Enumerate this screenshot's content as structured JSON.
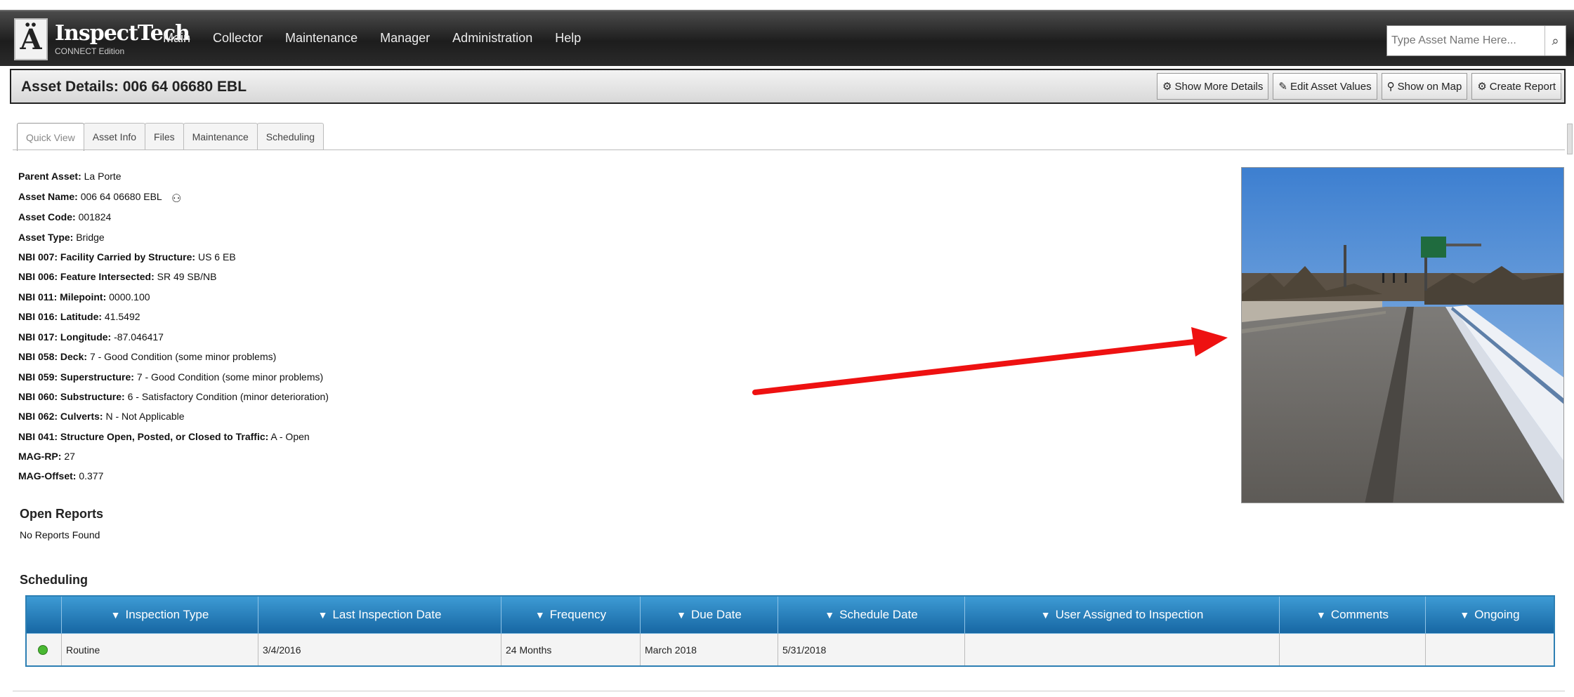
{
  "app": {
    "logo_name": "InspectTech",
    "logo_sub": "CONNECT Edition",
    "nav": [
      "Main",
      "Collector",
      "Maintenance",
      "Manager",
      "Administration",
      "Help"
    ],
    "search": {
      "placeholder": "Type Asset Name Here..."
    }
  },
  "header": {
    "title": "Asset Details: 006 64 06680 EBL",
    "actions": [
      {
        "label": "Show More Details",
        "icon": "gear-icon"
      },
      {
        "label": "Edit Asset Values",
        "icon": "edit-icon"
      },
      {
        "label": "Show on Map",
        "icon": "map-pin-icon"
      },
      {
        "label": "Create Report",
        "icon": "gear-icon"
      }
    ]
  },
  "tabs": [
    "Quick View",
    "Asset Info",
    "Files",
    "Maintenance",
    "Scheduling"
  ],
  "active_tab": "Quick View",
  "fields": [
    {
      "label": "Parent Asset:",
      "value": "La Porte"
    },
    {
      "label": "Asset Name:",
      "value": "006 64 06680 EBL"
    },
    {
      "label": "Asset Code:",
      "value": "001824"
    },
    {
      "label": "Asset Type:",
      "value": "Bridge"
    },
    {
      "label": "NBI 007: Facility Carried by Structure:",
      "value": "US 6 EB"
    },
    {
      "label": "NBI 006: Feature Intersected:",
      "value": "SR 49 SB/NB"
    },
    {
      "label": "NBI 011: Milepoint:",
      "value": "0000.100"
    },
    {
      "label": "NBI 016: Latitude:",
      "value": "41.5492"
    },
    {
      "label": "NBI 017: Longitude:",
      "value": "-87.046417"
    },
    {
      "label": "NBI 058: Deck:",
      "value": "7 - Good Condition (some minor problems)"
    },
    {
      "label": "NBI 059: Superstructure:",
      "value": "7 - Good Condition (some minor problems)"
    },
    {
      "label": "NBI 060: Substructure:",
      "value": "6 - Satisfactory Condition (minor deterioration)"
    },
    {
      "label": "NBI 062: Culverts:",
      "value": "N - Not Applicable"
    },
    {
      "label": "NBI 041: Structure Open, Posted, or Closed to Traffic:",
      "value": "A - Open"
    },
    {
      "label": "MAG-RP:",
      "value": "27"
    },
    {
      "label": "MAG-Offset:",
      "value": "0.377"
    }
  ],
  "open_reports": {
    "heading": "Open Reports",
    "empty_text": "No Reports Found"
  },
  "scheduling": {
    "heading": "Scheduling",
    "columns": [
      "Inspection Type",
      "Last Inspection Date",
      "Frequency",
      "Due Date",
      "Schedule Date",
      "User Assigned to Inspection",
      "Comments",
      "Ongoing"
    ],
    "rows": [
      {
        "status_color": "#49b832",
        "cells": [
          "Routine",
          "3/4/2016",
          "24 Months",
          "March 2018",
          "5/31/2018",
          "",
          "",
          ""
        ]
      }
    ]
  },
  "colors": {
    "annotation_arrow": "#ee1111",
    "grid_header": "#1f78b8"
  }
}
